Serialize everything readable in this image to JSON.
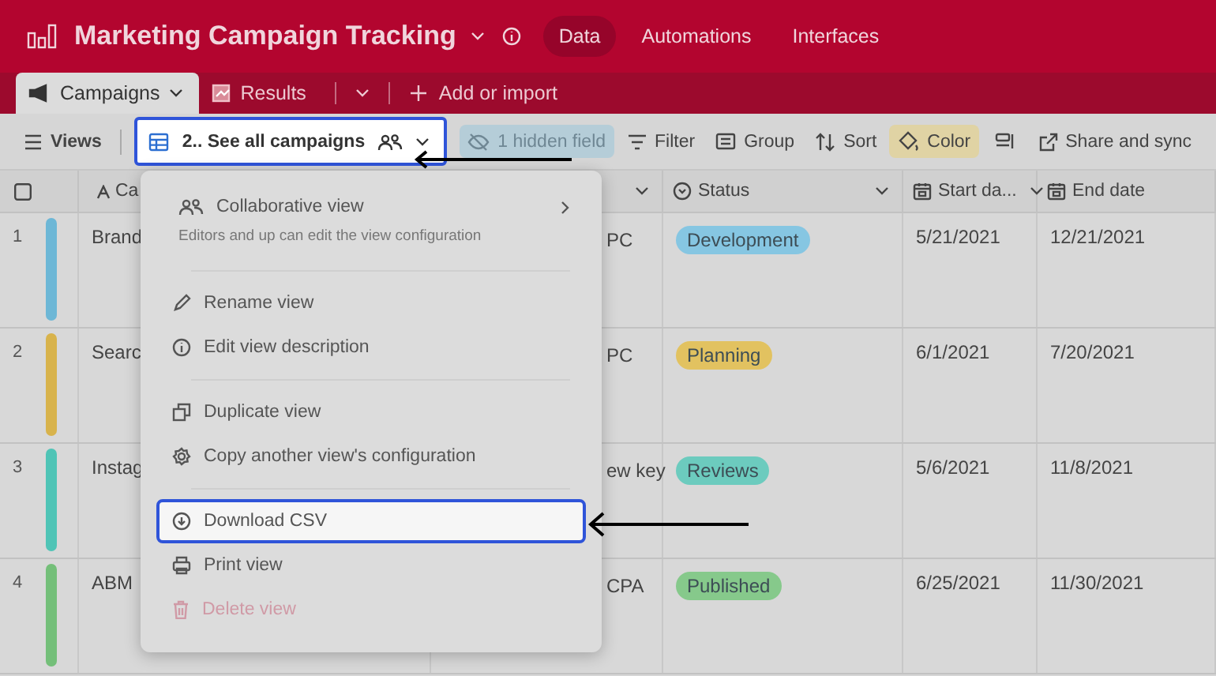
{
  "header": {
    "title": "Marketing Campaign Tracking",
    "nav": [
      {
        "label": "Data",
        "selected": true
      },
      {
        "label": "Automations",
        "selected": false
      },
      {
        "label": "Interfaces",
        "selected": false
      }
    ]
  },
  "tables": [
    {
      "label": "Campaigns",
      "selected": true,
      "kind": "campaigns"
    },
    {
      "label": "Results",
      "selected": false,
      "kind": "results"
    }
  ],
  "add_table": {
    "label": "Add or import"
  },
  "toolbar": {
    "views_label": "Views",
    "view": {
      "label": "2.. See all campaigns",
      "highlighted": true
    },
    "items": [
      {
        "kind": "hidden",
        "label": "1 hidden field"
      },
      {
        "kind": "filter",
        "label": "Filter"
      },
      {
        "kind": "group",
        "label": "Group"
      },
      {
        "kind": "sort",
        "label": "Sort"
      },
      {
        "kind": "color",
        "label": "Color"
      },
      {
        "kind": "row-height"
      },
      {
        "kind": "share",
        "label": "Share and sync"
      }
    ]
  },
  "grid": {
    "columns": [
      {
        "kind": "text",
        "label": "Ca"
      },
      {
        "kind": "hidden"
      },
      {
        "kind": "select",
        "label": "Status"
      },
      {
        "kind": "date",
        "label": "Start da..."
      },
      {
        "kind": "date",
        "label": "End date"
      }
    ],
    "rows": [
      {
        "number": "1",
        "color": "#6db7d6",
        "name": "Brand",
        "column_3": [
          "PC"
        ],
        "status": {
          "label": "Development",
          "color": "#86c6e2"
        },
        "start": "5/21/2021",
        "end": "12/21/2021"
      },
      {
        "number": "2",
        "color": "#d8b34c",
        "name": "Searc",
        "column_3": [
          "PC"
        ],
        "status": {
          "label": "Planning",
          "color": "#e2c260"
        },
        "start": "6/1/2021",
        "end": "7/20/2021"
      },
      {
        "number": "3",
        "color": "#4fc4b6",
        "name": "Instag",
        "column_3": [
          "ew key"
        ],
        "status": {
          "label": "Reviews",
          "color": "#6ccbbe"
        },
        "start": "5/6/2021",
        "end": "11/8/2021"
      },
      {
        "number": "4",
        "color": "#74bf79",
        "name": "ABM",
        "column_3": [
          "CPA"
        ],
        "status": {
          "label": "Published",
          "color": "#86c98b"
        },
        "start": "6/25/2021",
        "end": "11/30/2021"
      }
    ]
  },
  "menu": {
    "items": [
      {
        "kind": "collaborative",
        "label": "Collaborative view",
        "description": "Editors and up can edit the view configuration",
        "highlighted": false,
        "disabled": false
      },
      {
        "kind": "separator"
      },
      {
        "kind": "rename",
        "label": "Rename view",
        "highlighted": false,
        "disabled": false
      },
      {
        "kind": "describe",
        "label": "Edit view description",
        "highlighted": false,
        "disabled": false
      },
      {
        "kind": "separator"
      },
      {
        "kind": "duplicate",
        "label": "Duplicate view",
        "highlighted": false,
        "disabled": false
      },
      {
        "kind": "copy-config",
        "label": "Copy another view's configuration",
        "highlighted": false,
        "disabled": false
      },
      {
        "kind": "separator"
      },
      {
        "kind": "download",
        "label": "Download CSV",
        "highlighted": true,
        "disabled": false
      },
      {
        "kind": "print",
        "label": "Print view",
        "highlighted": false,
        "disabled": false
      },
      {
        "kind": "delete",
        "label": "Delete view",
        "highlighted": false,
        "disabled": true
      }
    ]
  }
}
